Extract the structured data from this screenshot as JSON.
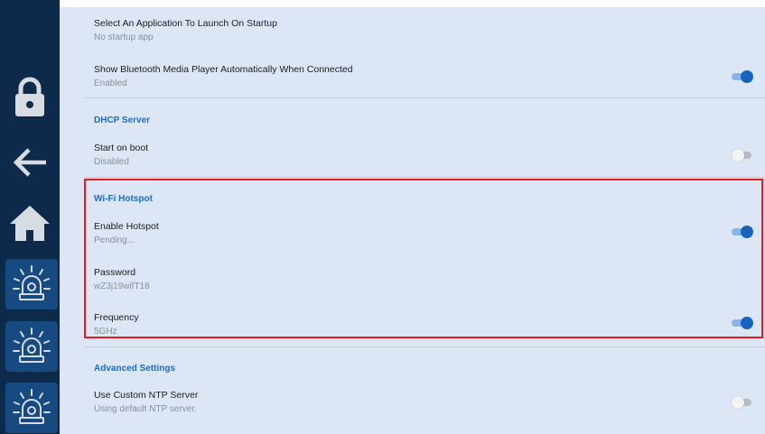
{
  "settings": {
    "startup_app": {
      "title": "Select An Application To Launch On Startup",
      "value": "No startup app"
    },
    "bt_media": {
      "title": "Show Bluetooth Media Player Automatically When Connected",
      "value": "Enabled",
      "on": true
    },
    "dhcp": {
      "header": "DHCP Server",
      "start_on_boot": {
        "title": "Start on boot",
        "value": "Disabled",
        "on": false
      }
    },
    "hotspot": {
      "header": "Wi-Fi Hotspot",
      "enable": {
        "title": "Enable Hotspot",
        "value": "Pending...",
        "on": true
      },
      "password": {
        "title": "Password",
        "value": "wZ3j19wifT18"
      },
      "frequency": {
        "title": "Frequency",
        "value": "5GHz",
        "on": true
      }
    },
    "advanced": {
      "header": "Advanced Settings",
      "ntp": {
        "title": "Use Custom NTP Server",
        "value": "Using default NTP server.",
        "on": false
      }
    }
  },
  "sidebar": {
    "icons": [
      "lock-icon",
      "back-arrow-icon",
      "home-icon",
      "alarm-beacon-icon",
      "alarm-beacon-icon",
      "alarm-beacon-icon"
    ]
  },
  "colors": {
    "sidebar_bg": "#0e2a4a",
    "content_bg": "#dce6f5",
    "accent": "#1565c0",
    "section_header": "#1f6bc4",
    "highlight": "#e51c23"
  }
}
